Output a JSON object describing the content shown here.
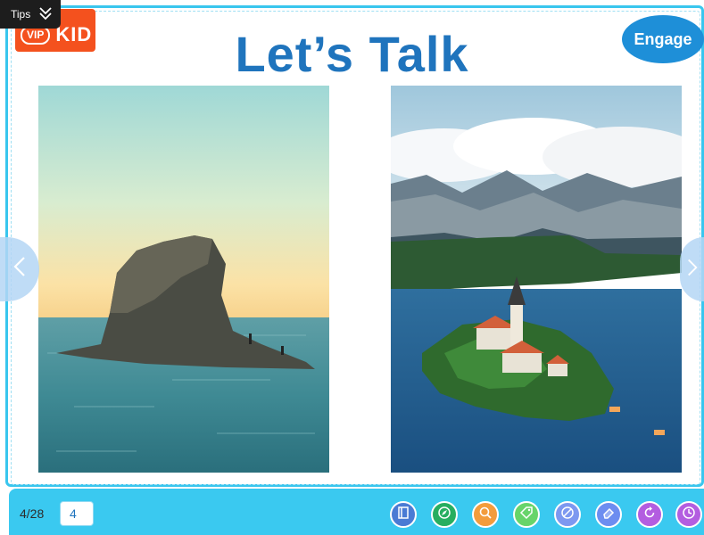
{
  "tips": {
    "label": "Tips"
  },
  "logo": {
    "vip": "VIP",
    "kid": "KID"
  },
  "slide": {
    "title": "Let’s Talk",
    "badge": "Engage",
    "photos": [
      {
        "name": "sea-stack-photo"
      },
      {
        "name": "lake-island-church-photo"
      }
    ]
  },
  "navigation": {
    "prev_icon": "chevron-left-icon",
    "next_icon": "chevron-right-icon"
  },
  "pager": {
    "count": "4/28",
    "current": "4"
  },
  "tools": [
    {
      "icon": "book-icon",
      "color": "#4a7bd4"
    },
    {
      "icon": "compass-icon",
      "color": "#27ae60"
    },
    {
      "icon": "magnifier-icon",
      "color": "#f39c3c"
    },
    {
      "icon": "tag-icon",
      "color": "#67d46a"
    },
    {
      "icon": "palette-icon",
      "color": "#7d98f0"
    },
    {
      "icon": "eraser-icon",
      "color": "#6d8df0"
    },
    {
      "icon": "refresh-icon",
      "color": "#b35de0"
    },
    {
      "icon": "clock-icon",
      "color": "#b35de0"
    }
  ]
}
